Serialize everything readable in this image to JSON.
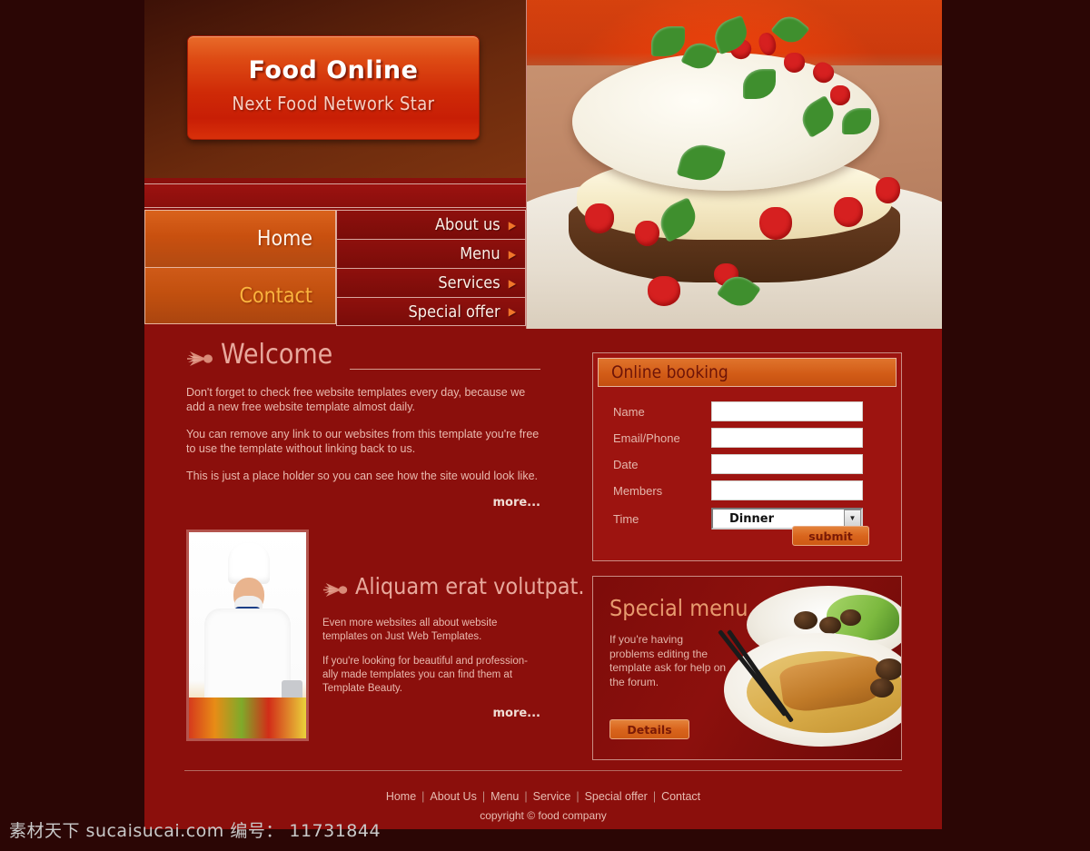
{
  "header": {
    "logo_title": "Food Online",
    "logo_subtitle": "Next Food Network Star",
    "photo_alt": "strawberry-cream-cake-photo"
  },
  "nav": {
    "primary": [
      {
        "label": "Home",
        "active": true
      },
      {
        "label": "Contact",
        "active": false
      }
    ],
    "secondary": [
      {
        "label": "About us",
        "arrow": "▶"
      },
      {
        "label": "Menu",
        "arrow": "▶"
      },
      {
        "label": "Services",
        "arrow": "▶"
      },
      {
        "label": "Special offer",
        "arrow": "▶"
      }
    ]
  },
  "welcome": {
    "title": "Welcome",
    "paragraph1": "Don't forget to check free website templates every day, because we add a new free website template almost daily.",
    "paragraph2": "You can remove any link to our websites from this template you're free to use the template without linking back to us.",
    "paragraph3": "This is just a place holder so you can see how the site would look like.",
    "more_label": "more..."
  },
  "chef": {
    "title": "Aliquam erat volutpat.",
    "photo_alt": "chef-portrait-photo",
    "paragraph1": "Even more websites all about website templates on Just Web Templates.",
    "paragraph2": "If you're looking for beautiful and profession-ally made templates you can find them at Template Beauty.",
    "more_label": "more..."
  },
  "booking": {
    "title": "Online booking",
    "fields": [
      {
        "label": "Name",
        "value": "",
        "type": "text"
      },
      {
        "label": "Email/Phone",
        "value": "",
        "type": "text"
      },
      {
        "label": "Date",
        "value": "",
        "type": "text"
      },
      {
        "label": "Members",
        "value": "",
        "type": "text"
      }
    ],
    "time": {
      "label": "Time",
      "value": "Dinner",
      "options": [
        "Dinner"
      ],
      "arrow": "▼"
    },
    "submit_label": "submit"
  },
  "special": {
    "title": "Special menu",
    "text": "If you're having problems editing the template ask for help on the forum.",
    "details_label": "Details",
    "photo_alt": "noodles-and-greens-photo"
  },
  "footer": {
    "links": [
      "Home",
      "About Us",
      "Menu",
      "Service",
      "Special offer",
      "Contact"
    ],
    "separator": "|",
    "copyright": "copyright © food company"
  },
  "watermark": {
    "text": "素材天下 sucaisucai.com  编号： 11731844"
  },
  "colors": {
    "page_background": "#2b0605",
    "site_background": "#8b0f0c",
    "accent_orange": "#d9651d",
    "panel_red": "#9d1410",
    "border_pink": "#c98c84",
    "text_rose": "#e9b9ae",
    "heading_rose": "#e8a89c",
    "contact_gold": "#fbb43e"
  }
}
